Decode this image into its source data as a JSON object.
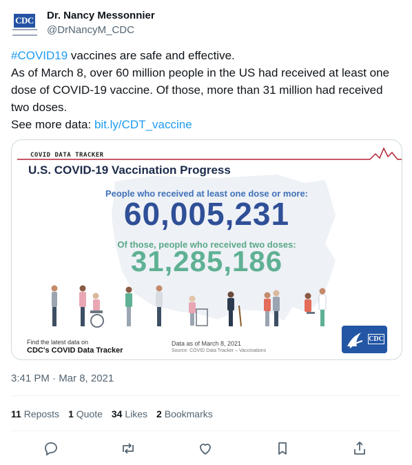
{
  "author": {
    "name": "Dr. Nancy Messonnier",
    "handle": "@DrNancyM_CDC",
    "avatar_logo": "CDC"
  },
  "tweet": {
    "hashtag": "#COVID19",
    "line1_rest": " vaccines are safe and effective.",
    "line2": "As of March 8, over 60 million people in the US had received at least one dose of COVID-19 vaccine. Of those, more than 31 million had received two doses.",
    "line3_prefix": "See more data: ",
    "link": "bit.ly/CDT_vaccine"
  },
  "card": {
    "tracker_label": "COVID DATA TRACKER",
    "title": "U.S. COVID-19 Vaccination Progress",
    "dose1_label": "People who received at least one dose or more:",
    "dose1_value": "60,005,231",
    "dose2_label": "Of those, people who received two doses:",
    "dose2_value": "31,285,186",
    "find_line1": "Find the latest data on",
    "find_line2": "CDC's COVID Data Tracker",
    "as_of": "Data as of March 8, 2021",
    "source": "Source: COVID Data Tracker – Vaccinations",
    "badge_logo": "CDC",
    "accent_red": "#b22234",
    "blue": "#2f4f97",
    "green": "#5fb194"
  },
  "timestamp": "3:41 PM · Mar 8, 2021",
  "stats": {
    "reposts_count": "11",
    "reposts_label": "Reposts",
    "quotes_count": "1",
    "quotes_label": "Quote",
    "likes_count": "34",
    "likes_label": "Likes",
    "bookmarks_count": "2",
    "bookmarks_label": "Bookmarks"
  },
  "actions": [
    "reply-icon",
    "repost-icon",
    "like-icon",
    "bookmark-icon",
    "share-icon"
  ]
}
